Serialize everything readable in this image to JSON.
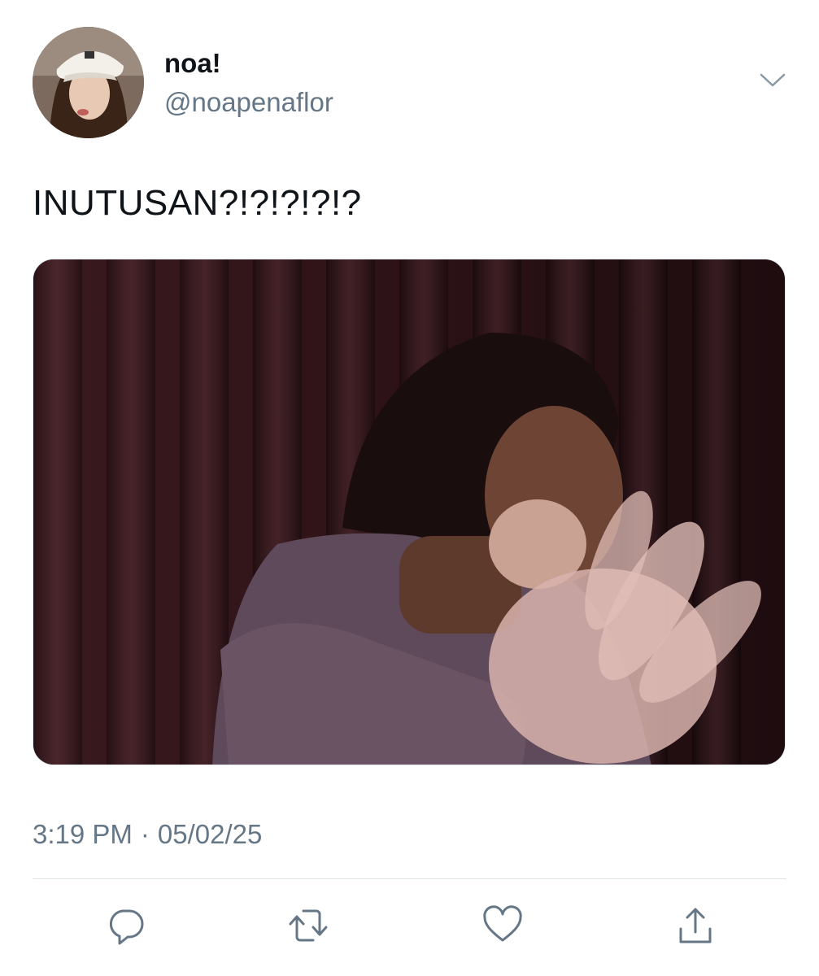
{
  "tweet": {
    "author": {
      "display_name": "noa!",
      "handle": "@noapenaflor"
    },
    "text": "INUTUSAN?!?!?!?!?",
    "timestamp": {
      "time": "3:19 PM",
      "separator": "·",
      "date": "05/02/25"
    }
  },
  "icons": {
    "menu": "chevron-down-icon",
    "reply": "reply-icon",
    "retweet": "retweet-icon",
    "like": "heart-icon",
    "share": "share-icon"
  },
  "colors": {
    "text_primary": "#0f1419",
    "text_secondary": "#657786",
    "icon": "#657786",
    "divider": "#dde3e8",
    "background": "#ffffff"
  }
}
